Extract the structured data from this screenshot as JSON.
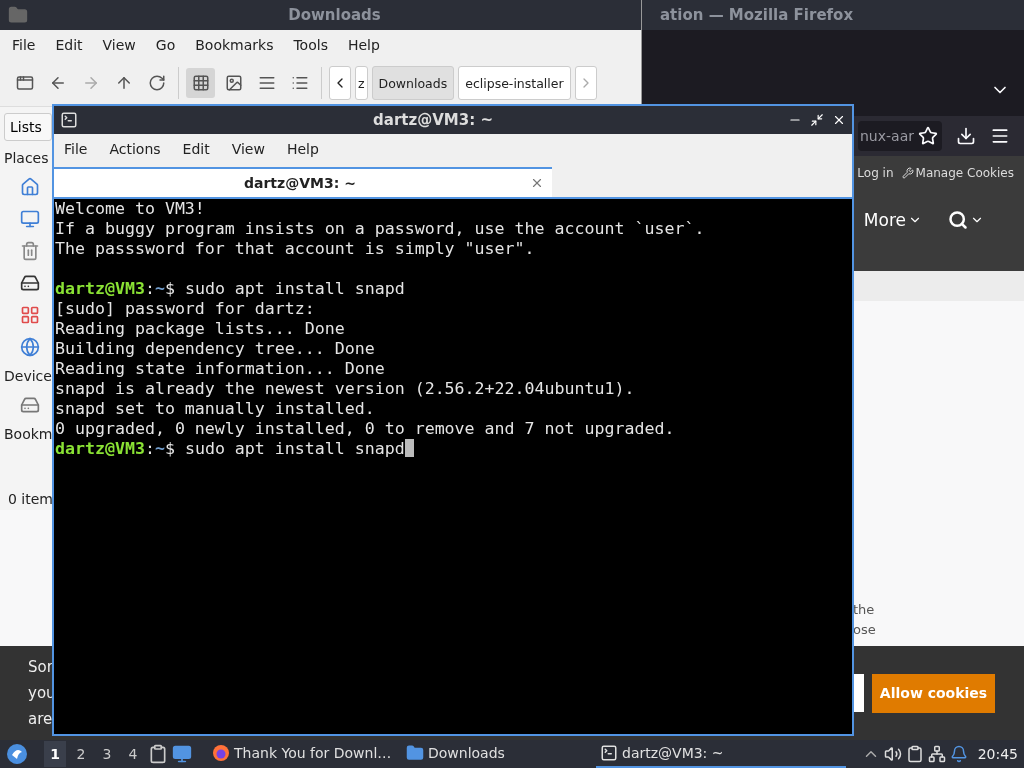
{
  "browser": {
    "title": "ation — Mozilla Firefox",
    "url_fragment": "nux-aar",
    "header_links": [
      {
        "label": "Log in"
      },
      {
        "label": "Manage Cookies",
        "kind": "wrench"
      }
    ],
    "nav": [
      {
        "label": "More",
        "kind": "menu"
      },
      {
        "kind": "search"
      }
    ],
    "content_lines": [
      "the",
      "ose"
    ],
    "cookie_banner": {
      "lines": [
        "Sor",
        "you",
        "are"
      ],
      "button": "Allow cookies"
    }
  },
  "file_manager": {
    "title": "Downloads",
    "menu": [
      "File",
      "Edit",
      "View",
      "Go",
      "Bookmarks",
      "Tools",
      "Help"
    ],
    "view_modes": [
      {
        "kind": "icons",
        "selected": true
      },
      {
        "kind": "thumbnails",
        "selected": false
      },
      {
        "kind": "compact",
        "selected": false
      },
      {
        "kind": "details",
        "selected": false
      }
    ],
    "path": [
      {
        "label": "z",
        "selected": false
      },
      {
        "label": "Downloads",
        "selected": true
      },
      {
        "label": "eclipse-installer",
        "selected": false
      }
    ],
    "side_pane": {
      "mode": "Lists",
      "sections": [
        {
          "title": "Places",
          "items": [
            {
              "kind": "home"
            },
            {
              "kind": "desktop"
            },
            {
              "kind": "trash"
            },
            {
              "kind": "computer"
            },
            {
              "kind": "apps"
            },
            {
              "kind": "network"
            }
          ]
        },
        {
          "title": "Device",
          "items": [
            {
              "kind": "drive"
            }
          ]
        },
        {
          "title": "Bookm"
        }
      ]
    },
    "status": "0 item"
  },
  "terminal": {
    "title": "dartz@VM3: ~",
    "menu": [
      "File",
      "Actions",
      "Edit",
      "View",
      "Help"
    ],
    "tabs": [
      {
        "label": "dartz@VM3: ~",
        "selected": true
      }
    ],
    "lines": [
      {
        "kind": "output",
        "text": "Welcome to VM3!"
      },
      {
        "kind": "output",
        "text": "If a buggy program insists on a password, use the account `user`."
      },
      {
        "kind": "output",
        "text": "The passsword for that account is simply \"user\"."
      },
      {
        "kind": "blank"
      },
      {
        "kind": "prompt",
        "user": "dartz@VM3",
        "sep": ":",
        "path": "~",
        "symbol": "$",
        "command": "sudo apt install snapd",
        "cursor": false
      },
      {
        "kind": "output",
        "text": "[sudo] password for dartz:"
      },
      {
        "kind": "output",
        "text": "Reading package lists... Done"
      },
      {
        "kind": "output",
        "text": "Building dependency tree... Done"
      },
      {
        "kind": "output",
        "text": "Reading state information... Done"
      },
      {
        "kind": "output",
        "text": "snapd is already the newest version (2.56.2+22.04ubuntu1)."
      },
      {
        "kind": "output",
        "text": "snapd set to manually installed."
      },
      {
        "kind": "output",
        "text": "0 upgraded, 0 newly installed, 0 to remove and 7 not upgraded."
      },
      {
        "kind": "prompt",
        "user": "dartz@VM3",
        "sep": ":",
        "path": "~",
        "symbol": "$",
        "command": "sudo apt install snapd",
        "cursor": true
      }
    ]
  },
  "taskbar": {
    "workspaces": [
      {
        "label": "1",
        "selected": true
      },
      {
        "label": "2",
        "selected": false
      },
      {
        "label": "3",
        "selected": false
      },
      {
        "label": "4",
        "selected": false
      }
    ],
    "tasks": [
      {
        "label": "Thank You for Downl…",
        "kind": "browser",
        "selected": false
      },
      {
        "label": "Downloads",
        "kind": "folder",
        "selected": false
      },
      {
        "label": "dartz@VM3: ~",
        "kind": "terminal",
        "selected": true
      }
    ],
    "clock": "20:45"
  }
}
